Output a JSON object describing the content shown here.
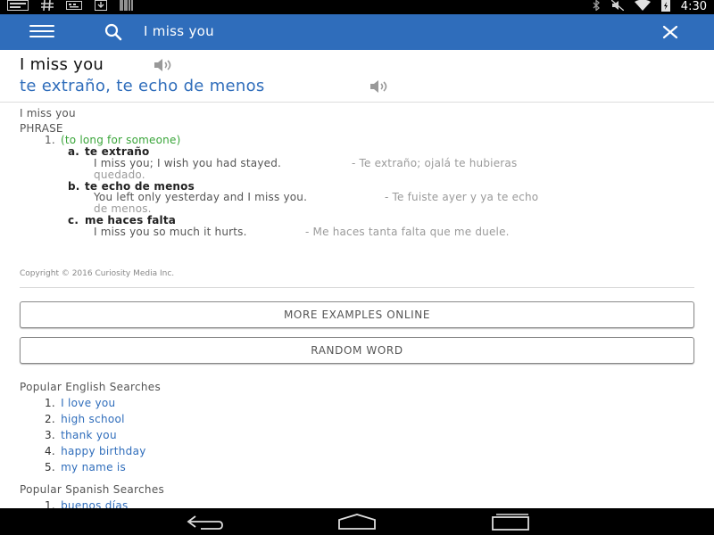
{
  "status_bar": {
    "time": "4:30",
    "left_icons": [
      "news-app-icon",
      "hashtag-icon",
      "keyboard-icon",
      "download-icon",
      "barcode-icon"
    ],
    "right_icons": [
      "bluetooth-icon",
      "mute-icon",
      "wifi-icon",
      "battery-charging-icon"
    ]
  },
  "app_bar": {
    "query": "I miss you",
    "background": "#2f6dbb"
  },
  "entry": {
    "headword": "I miss you",
    "translation": "te extraño, te echo de menos"
  },
  "definition": {
    "title": "I miss you",
    "part_of_speech": "PHRASE",
    "sense_number": "1.",
    "sense_gloss": "(to long for someone)",
    "subsenses": [
      {
        "letter": "a.",
        "term": "te extraño",
        "example_en": "I miss you; I wish you had stayed.",
        "example_es_line1": "- Te extraño; ojalá te hubieras",
        "example_es_line2": "quedado."
      },
      {
        "letter": "b.",
        "term": "te echo de menos",
        "example_en": "You left only yesterday and I miss you.",
        "example_es_line1": "- Te fuiste ayer y ya te echo",
        "example_es_line2": "de menos."
      },
      {
        "letter": "c.",
        "term": "me haces falta",
        "example_en": "I miss you so much it hurts.",
        "example_es_line1": "- Me haces tanta falta que me duele."
      }
    ],
    "copyright": "Copyright © 2016 Curiosity Media Inc."
  },
  "buttons": {
    "more_examples": "MORE EXAMPLES ONLINE",
    "random_word": "RANDOM WORD"
  },
  "popular_english": {
    "title": "Popular English Searches",
    "items": [
      {
        "num": "1.",
        "text": "I love you"
      },
      {
        "num": "2.",
        "text": "high school"
      },
      {
        "num": "3.",
        "text": "thank you"
      },
      {
        "num": "4.",
        "text": "happy birthday"
      },
      {
        "num": "5.",
        "text": "my name is"
      }
    ]
  },
  "popular_spanish": {
    "title": "Popular Spanish Searches",
    "items": [
      {
        "num": "1.",
        "text": "buenos días"
      }
    ]
  },
  "colors": {
    "accent": "#2f6dbb",
    "gloss_green": "#3aa53a"
  }
}
